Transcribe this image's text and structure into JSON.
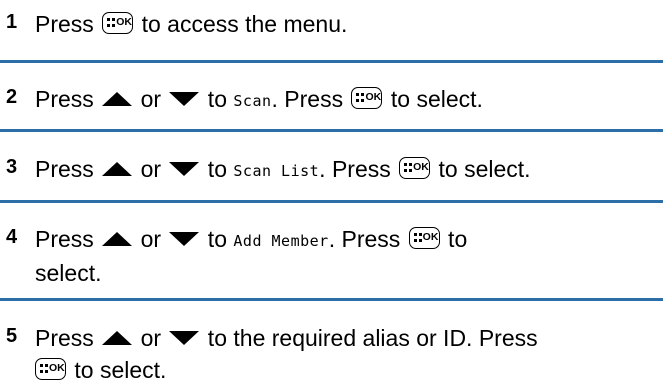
{
  "icons": {
    "menu_ok_key": "menu-ok-key-icon",
    "up": "up-arrow-icon",
    "down": "down-arrow-icon"
  },
  "colors": {
    "divider": "#2c6fa8"
  },
  "steps": [
    {
      "number": "1",
      "press": "Press",
      "after_key": " to access the menu."
    },
    {
      "number": "2",
      "press": "Press",
      "or": " or ",
      "to": " to ",
      "target": "Scan",
      "press2": ". Press ",
      "after_key": " to select."
    },
    {
      "number": "3",
      "press": "Press",
      "or": " or ",
      "to": " to ",
      "target": "Scan List",
      "press2": ". Press ",
      "after_key": " to select."
    },
    {
      "number": "4",
      "press": "Press",
      "or": " or ",
      "to": " to ",
      "target": "Add Member",
      "press2": ". Press ",
      "after_key": " to",
      "line2": "select."
    },
    {
      "number": "5",
      "press": "Press",
      "or": " or ",
      "line1_end": " to the required alias or ID. Press",
      "after_key": " to select."
    }
  ]
}
